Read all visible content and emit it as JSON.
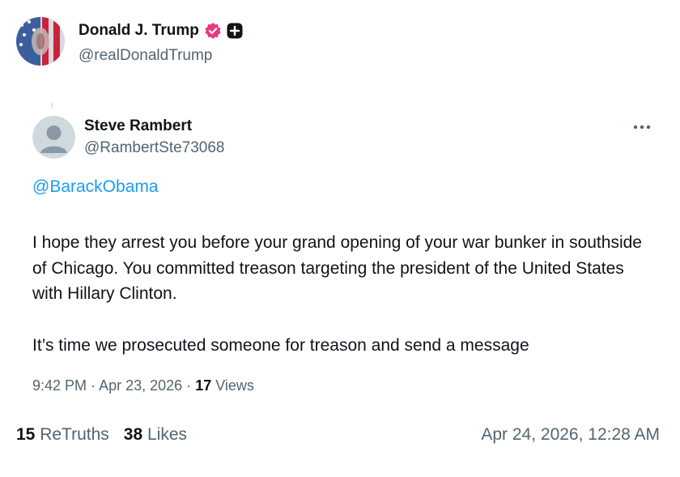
{
  "truth": {
    "author_name": "Donald J. Trump",
    "author_handle": "@realDonaldTrump",
    "retruths_count": "15",
    "retruths_label": "ReTruths",
    "likes_count": "38",
    "likes_label": "Likes",
    "timestamp": "Apr 24, 2026, 12:28 AM",
    "verified_color": "#e8397c"
  },
  "embedded_post": {
    "author_name": "Steve Rambert",
    "author_handle": "@RambertSte73068",
    "mention": "@BarackObama",
    "paragraph_1": "I hope they arrest you before your grand opening of your war bunker in southside of Chicago. You committed treason targeting the president of the United States with Hillary Clinton.",
    "paragraph_2": "It’s time we prosecuted someone for treason and send a message",
    "time": "9:42 PM",
    "separator": "·",
    "date": "Apr 23, 2026",
    "views_count": "17",
    "views_label": "Views",
    "link_color": "#1d9bf0"
  },
  "icons": {
    "verified": "verified-badge-icon",
    "plus": "plus-square-icon",
    "more": "more-horizontal-icon",
    "avatar_placeholder": "default-avatar-icon"
  }
}
